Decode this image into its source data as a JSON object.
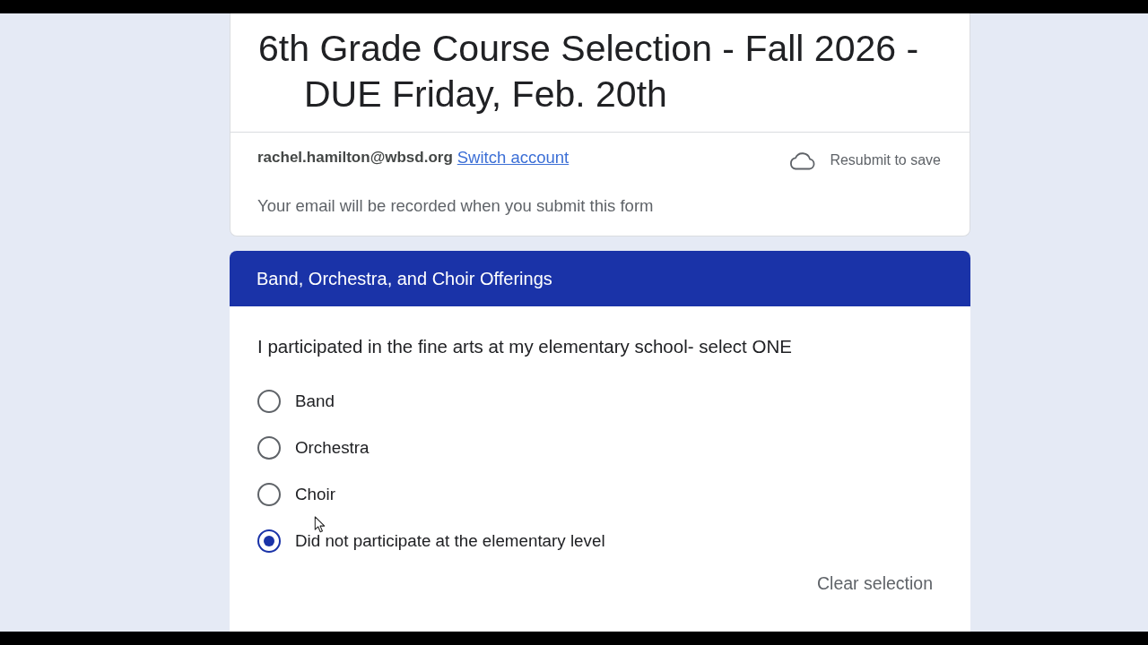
{
  "form": {
    "title": "6th Grade Course Selection - Fall 2026 - DUE Friday, Feb. 20th"
  },
  "account": {
    "email": "rachel.hamilton@wbsd.org",
    "switch_link": "Switch account",
    "save_status": "Resubmit to save",
    "notice": "Your email will be recorded when you submit this form"
  },
  "section": {
    "title": "Band, Orchestra, and Choir Offerings"
  },
  "question": {
    "text": "I participated in the fine arts at my elementary school- select ONE",
    "options": [
      {
        "label": "Band",
        "selected": false
      },
      {
        "label": "Orchestra",
        "selected": false
      },
      {
        "label": "Choir",
        "selected": false
      },
      {
        "label": "Did not participate at the elementary level",
        "selected": true
      }
    ],
    "clear_button": "Clear selection"
  }
}
